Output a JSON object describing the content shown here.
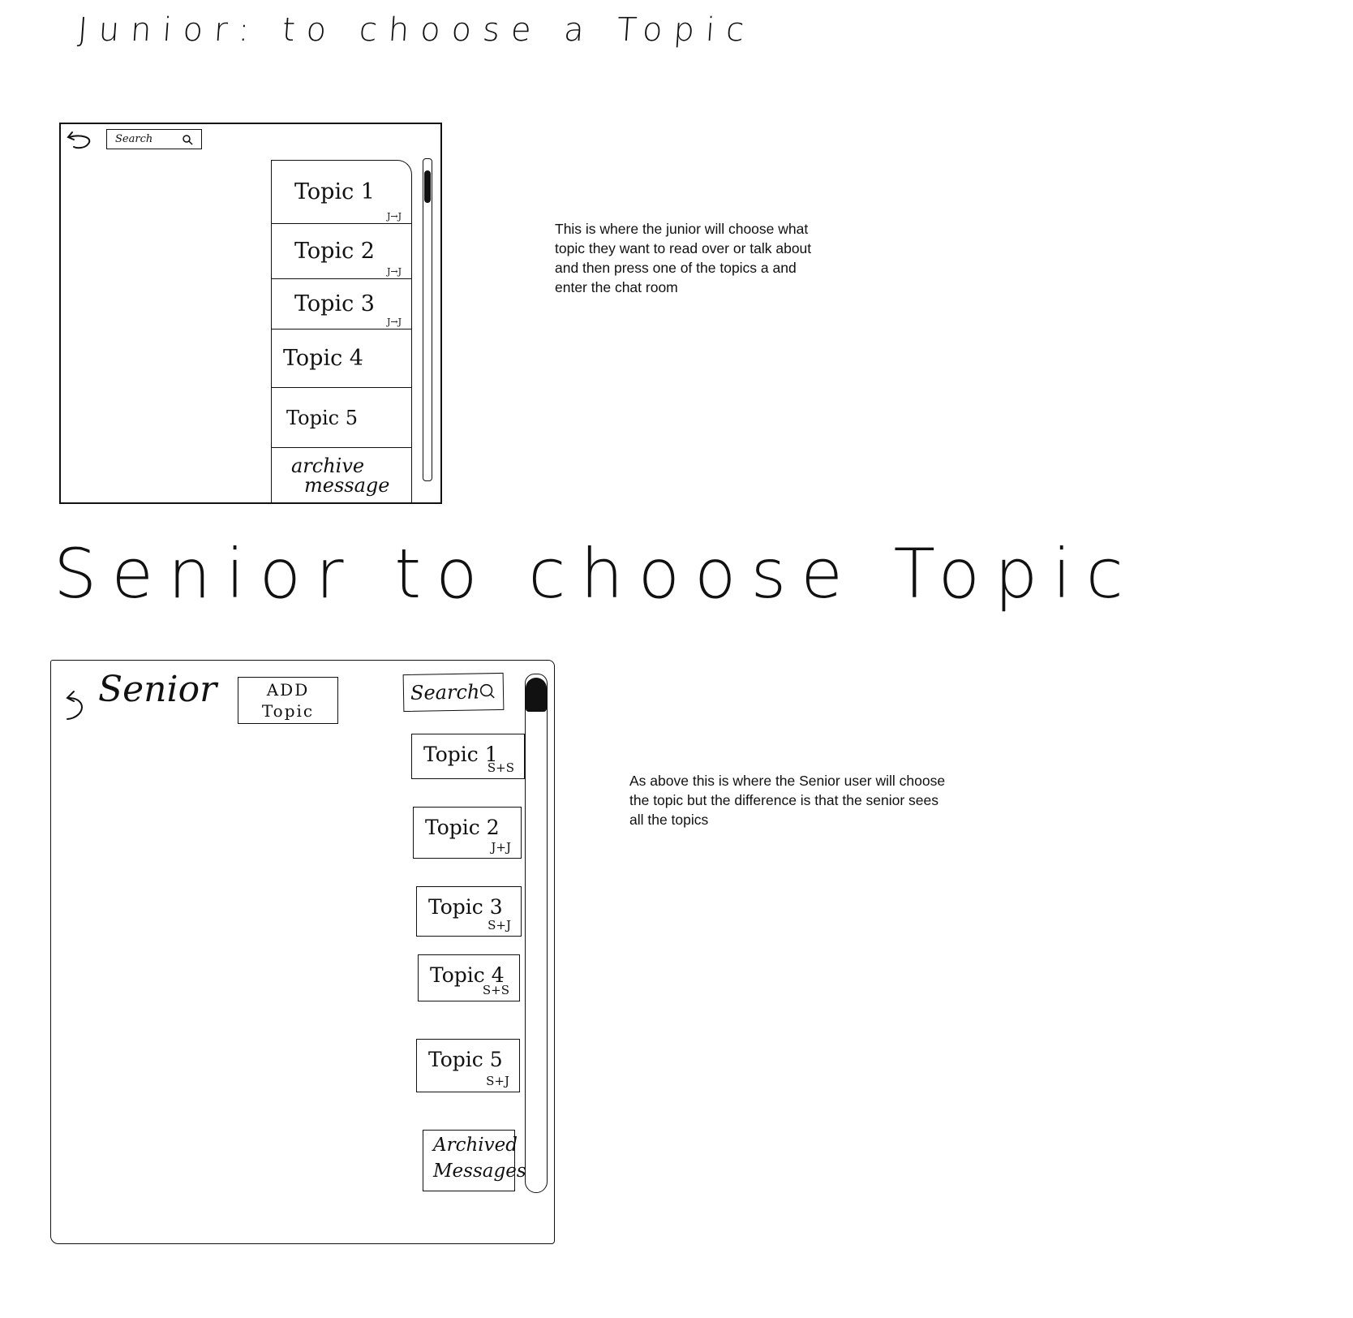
{
  "junior": {
    "title": "Junior: to choose a Topic",
    "note": "This is where the junior will choose what topic they want to read over or talk about and then press one of the topics a and enter the chat room",
    "search": {
      "label": "Search",
      "icon": "search-icon"
    },
    "back_icon": "back-arrow-icon",
    "topics": [
      {
        "label": "Topic 1",
        "tag": "J→J"
      },
      {
        "label": "Topic 2",
        "tag": "J→J"
      },
      {
        "label": "Topic 3",
        "tag": "J→J"
      },
      {
        "label": "Topic 4",
        "tag": ""
      },
      {
        "label": "Topic 5",
        "tag": ""
      }
    ],
    "archive": {
      "line1": "archive",
      "line2": "message"
    }
  },
  "senior": {
    "title": "Senior to choose Topic",
    "note": "As above this is where the Senior user will choose the topic but the difference is that the senior sees all the topics",
    "label": "Senior",
    "add_topic": {
      "line1": "ADD",
      "line2": "Topic"
    },
    "search": {
      "label": "Search",
      "icon": "search-icon"
    },
    "back_icon": "back-arrow-icon",
    "topics": [
      {
        "label": "Topic 1",
        "tag": "S+S"
      },
      {
        "label": "Topic 2",
        "tag": "J+J"
      },
      {
        "label": "Topic 3",
        "tag": "S+J"
      },
      {
        "label": "Topic 4",
        "tag": "S+S"
      },
      {
        "label": "Topic 5",
        "tag": "S+J"
      }
    ],
    "archive": {
      "line1": "Archived",
      "line2": "Messages"
    }
  }
}
